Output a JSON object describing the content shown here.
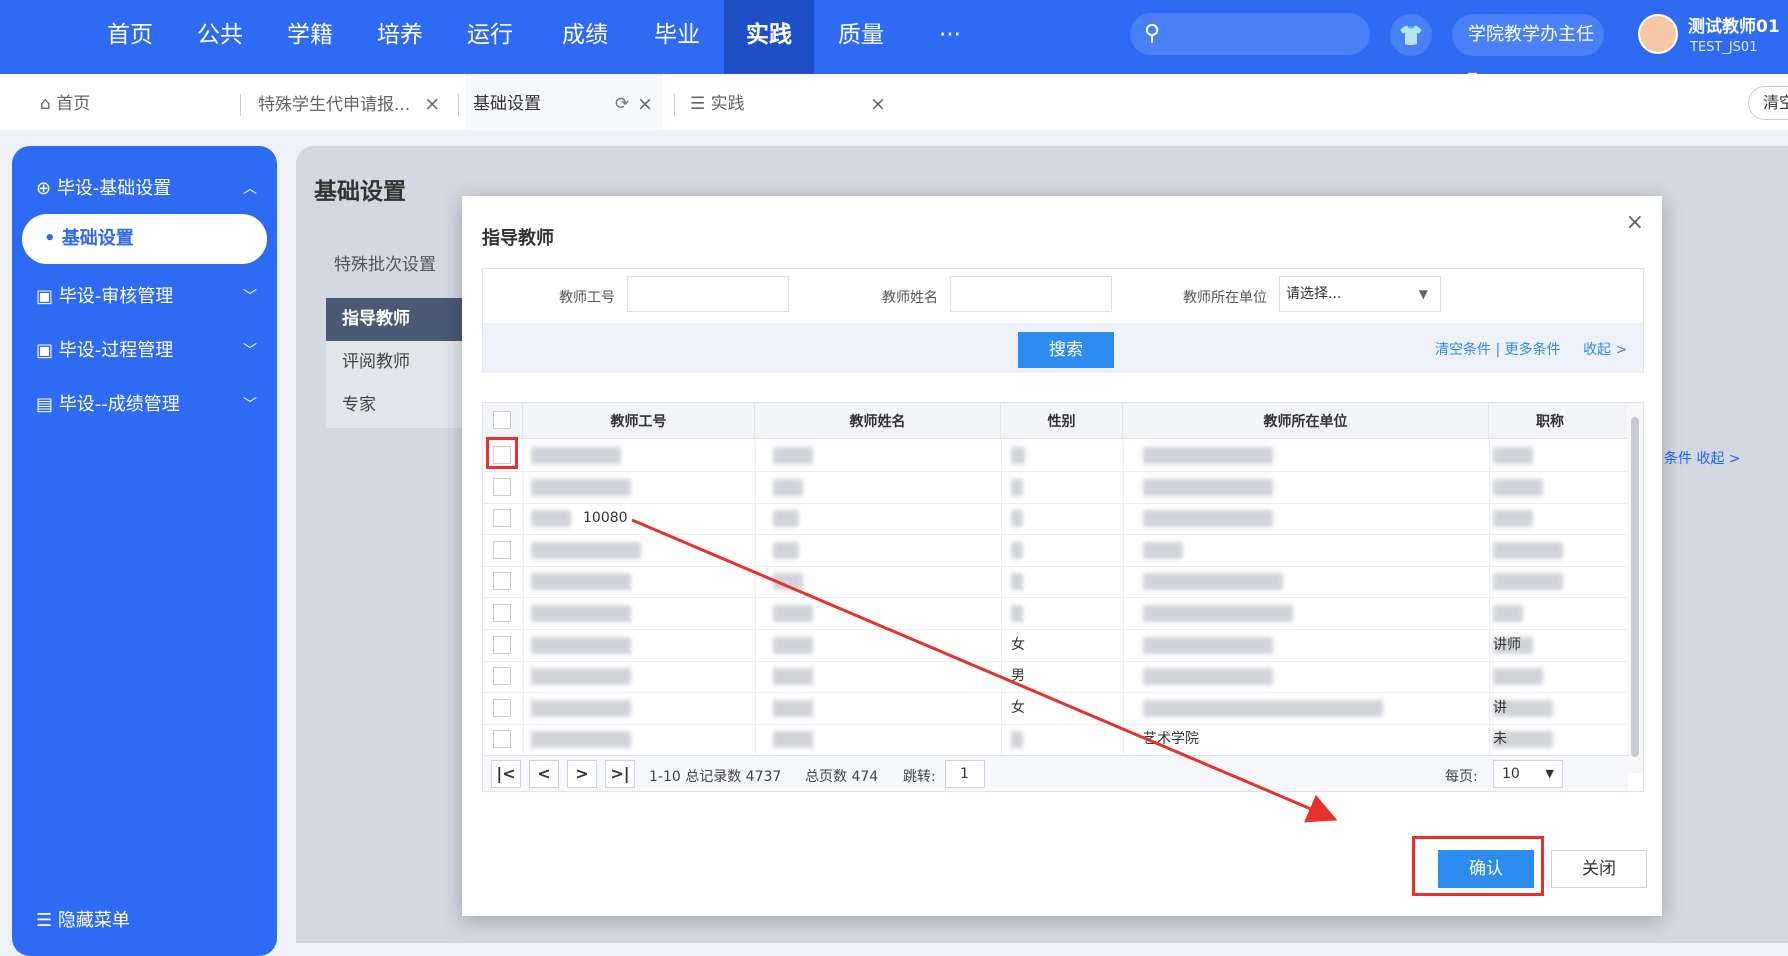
{
  "topnav": {
    "items": [
      "首页",
      "公共",
      "学籍",
      "培养",
      "运行",
      "成绩",
      "毕业",
      "实践",
      "质量",
      "···"
    ],
    "active": "实践",
    "role": "学院教学办主任 ▾",
    "user_name": "测试教师01",
    "user_id": "TEST_JS01"
  },
  "tabs": {
    "home": "首页",
    "tab1": "特殊学生代申请报...",
    "tab2": "基础设置",
    "tab3": "实践",
    "close_glyph": "×",
    "refresh_glyph": "⟳",
    "clear_btn": "清空"
  },
  "sidebar": {
    "items": [
      {
        "label": "毕设-基础设置",
        "chev": "︿"
      },
      {
        "label": "基础设置"
      },
      {
        "label": "毕设-审核管理",
        "chev": "﹀"
      },
      {
        "label": "毕设-过程管理",
        "chev": "﹀"
      },
      {
        "label": "毕设--成绩管理",
        "chev": "﹀"
      }
    ],
    "hide_menu": "☰ 隐藏菜单"
  },
  "main": {
    "title": "基础设置",
    "subtab": "特殊批次设置",
    "list": [
      "指导教师",
      "评阅教师",
      "专家"
    ],
    "bg_links": "条件  收起 >"
  },
  "modal": {
    "title": "指导教师",
    "close": "×",
    "filter": {
      "label_id": "教师工号",
      "label_name": "教师姓名",
      "label_unit": "教师所在单位",
      "unit_placeholder": "请选择...",
      "search_btn": "搜索",
      "links": "清空条件 | 更多条件",
      "collapse": "收起 >"
    },
    "table": {
      "columns": [
        "教师工号",
        "教师姓名",
        "性别",
        "教师所在单位",
        "职称"
      ],
      "rows": [
        {
          "id": "",
          "name": "",
          "gender": "",
          "unit": "",
          "title": ""
        },
        {
          "id": "",
          "name": "",
          "gender": "",
          "unit": "",
          "title": ""
        },
        {
          "id": "10080",
          "name": "",
          "gender": "",
          "unit": "",
          "title": ""
        },
        {
          "id": "",
          "name": "",
          "gender": "",
          "unit": "",
          "title": ""
        },
        {
          "id": "",
          "name": "",
          "gender": "",
          "unit": "",
          "title": ""
        },
        {
          "id": "",
          "name": "",
          "gender": "",
          "unit": "",
          "title": ""
        },
        {
          "id": "",
          "name": "",
          "gender": "女",
          "unit": "",
          "title": "讲师"
        },
        {
          "id": "",
          "name": "",
          "gender": "男",
          "unit": "",
          "title": ""
        },
        {
          "id": "",
          "name": "",
          "gender": "女",
          "unit": "",
          "title": "讲"
        },
        {
          "id": "",
          "name": "",
          "gender": "",
          "unit": "艺术学院",
          "title": "未"
        }
      ]
    },
    "pager": {
      "first": "|<",
      "prev": "<",
      "next": ">",
      "last": ">|",
      "range": "1-10 总记录数 4737",
      "pages": "总页数 474",
      "jump_label": "跳转:",
      "jump_value": "1",
      "per_page_label": "每页:",
      "per_page_value": "10"
    },
    "confirm": "确认",
    "close_btn": "关闭"
  },
  "colors": {
    "primary": "#2f6bf2",
    "button": "#2d8cf0",
    "annotation": "#e5322d"
  }
}
